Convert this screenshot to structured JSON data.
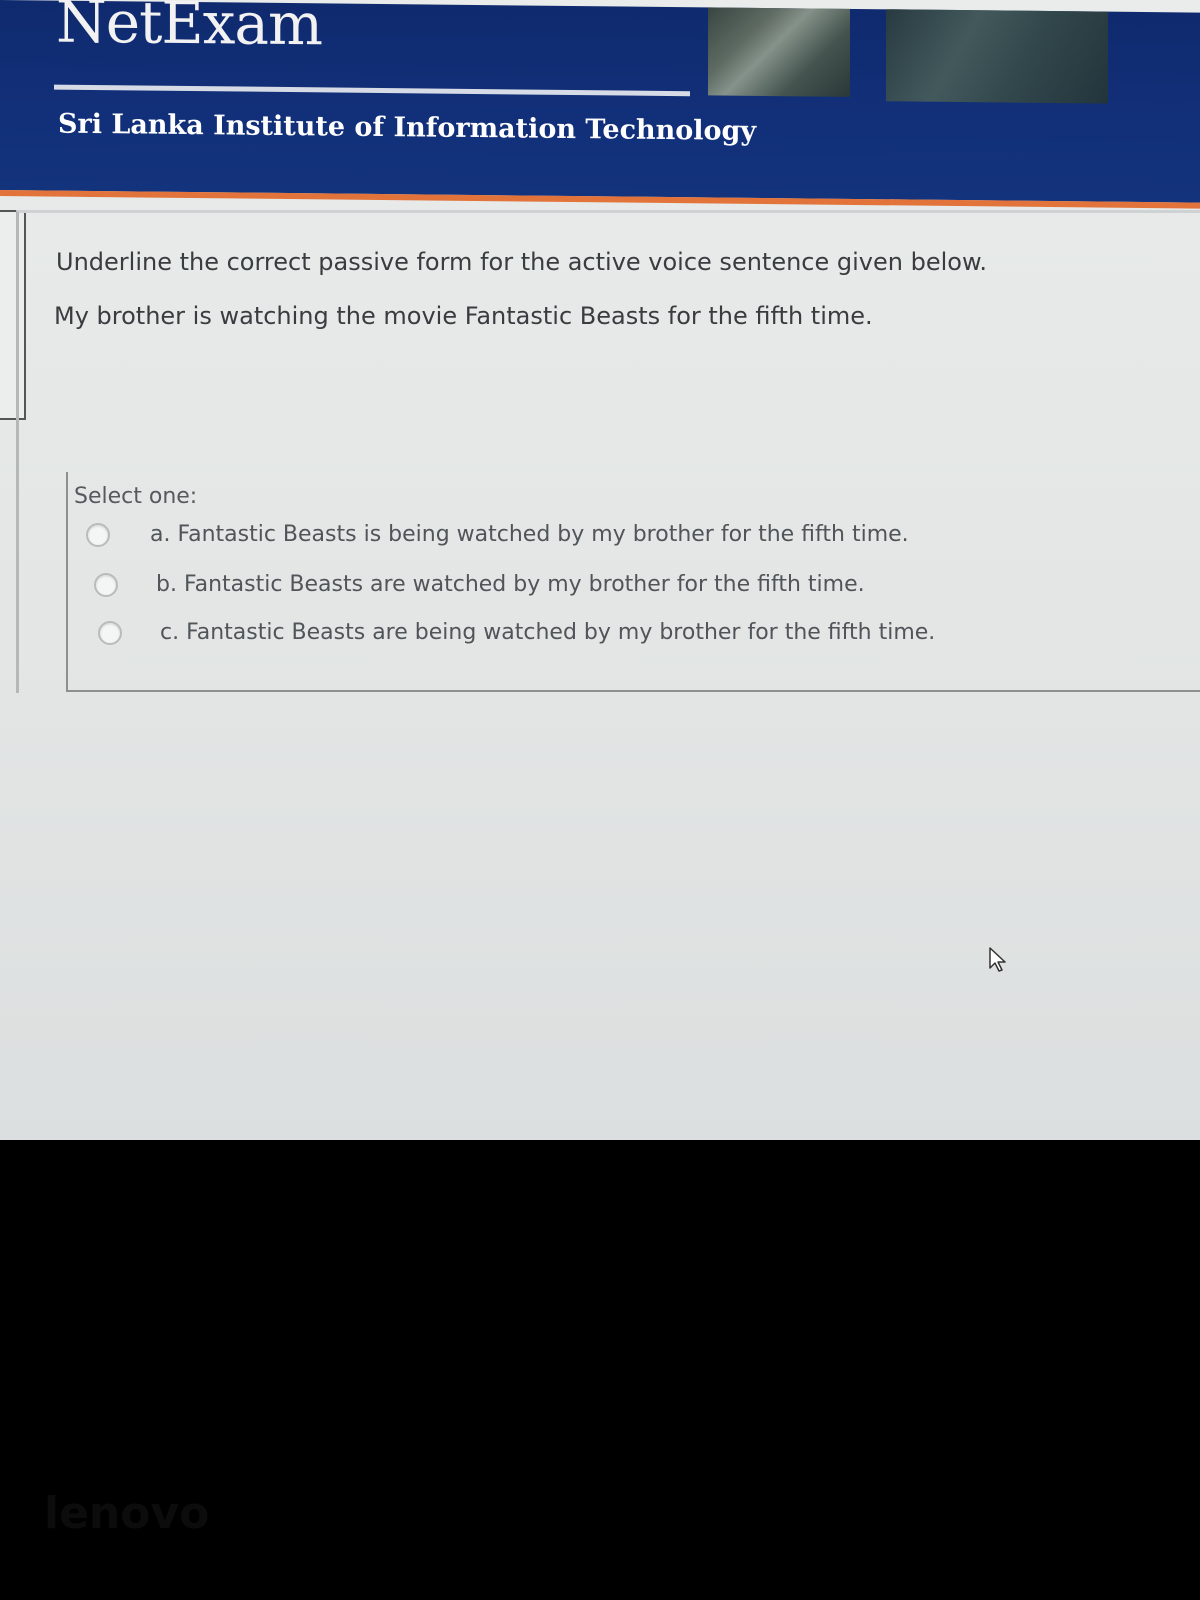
{
  "header": {
    "logo": "NetExam",
    "institute": "Sri Lanka Institute of Information Technology"
  },
  "question": {
    "prompt": "Underline the correct passive form for the active voice sentence given below.",
    "sentence": "My brother is watching the movie Fantastic Beasts for the fifth time."
  },
  "answer": {
    "select_label": "Select one:",
    "options": [
      {
        "label": "a. Fantastic Beasts is being watched by my brother for the fifth time.",
        "selected": false
      },
      {
        "label": "b. Fantastic Beasts are watched by my brother for the fifth time.",
        "selected": false
      },
      {
        "label": "c. Fantastic Beasts are being watched by my brother for the fifth time.",
        "selected": false
      }
    ]
  },
  "bezel": {
    "brand": "lenovo"
  },
  "colors": {
    "header_bg": "#12307a",
    "accent_stripe": "#e2733a",
    "page_bg": "#e6e9e8"
  }
}
